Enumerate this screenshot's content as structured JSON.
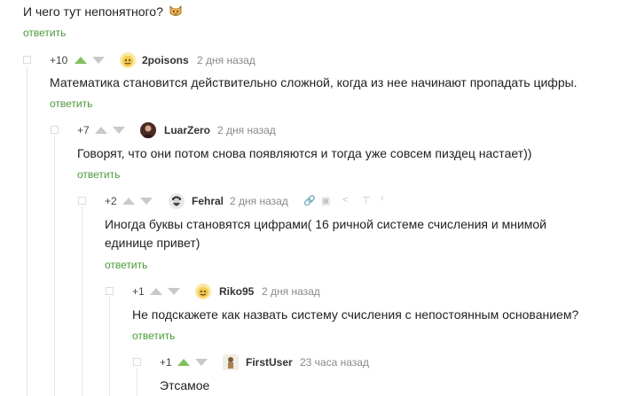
{
  "top": {
    "text": "И чего тут непонятного?",
    "reply": "ответить"
  },
  "comments": [
    {
      "rating": "+10",
      "nick": "2poisons",
      "time": "2 дня назад",
      "text": [
        "Математика становится действительно сложной, когда из нее начинают пропадать цифры."
      ],
      "reply": "ответить"
    },
    {
      "rating": "+7",
      "nick": "LuarZero",
      "time": "2 дня назад",
      "text": [
        "Говорят, что они потом снова появляются и тогда уже совсем пиздец настает))"
      ],
      "reply": "ответить"
    },
    {
      "rating": "+2",
      "nick": "Fehral",
      "time": "2 дня назад",
      "text": [
        "Иногда буквы становятся цифрами( 16 ричной системе счисления и мнимой",
        "единице привет)"
      ],
      "reply": "ответить"
    },
    {
      "rating": "+1",
      "nick": "Riko95",
      "time": "2 дня назад",
      "text": [
        "Не подскажете как назвать систему счисления с непостоянным основанием?"
      ],
      "reply": "ответить"
    },
    {
      "rating": "+1",
      "nick": "FirstUser",
      "time": "23 часа назад",
      "text": [
        "Этсамое"
      ]
    }
  ],
  "colors": {
    "reply": "#4a9a3a",
    "upvote_active": "#7fc15e",
    "arrow_inactive": "#c9c9c9"
  },
  "icons": {
    "top": "cat-emoji-icon",
    "c0": "smiley-avatar-icon",
    "c1": "photo-avatar-icon",
    "c2": "bearded-man-avatar-icon",
    "c3": "smiley-avatar-icon",
    "c4": "character-avatar-icon"
  }
}
